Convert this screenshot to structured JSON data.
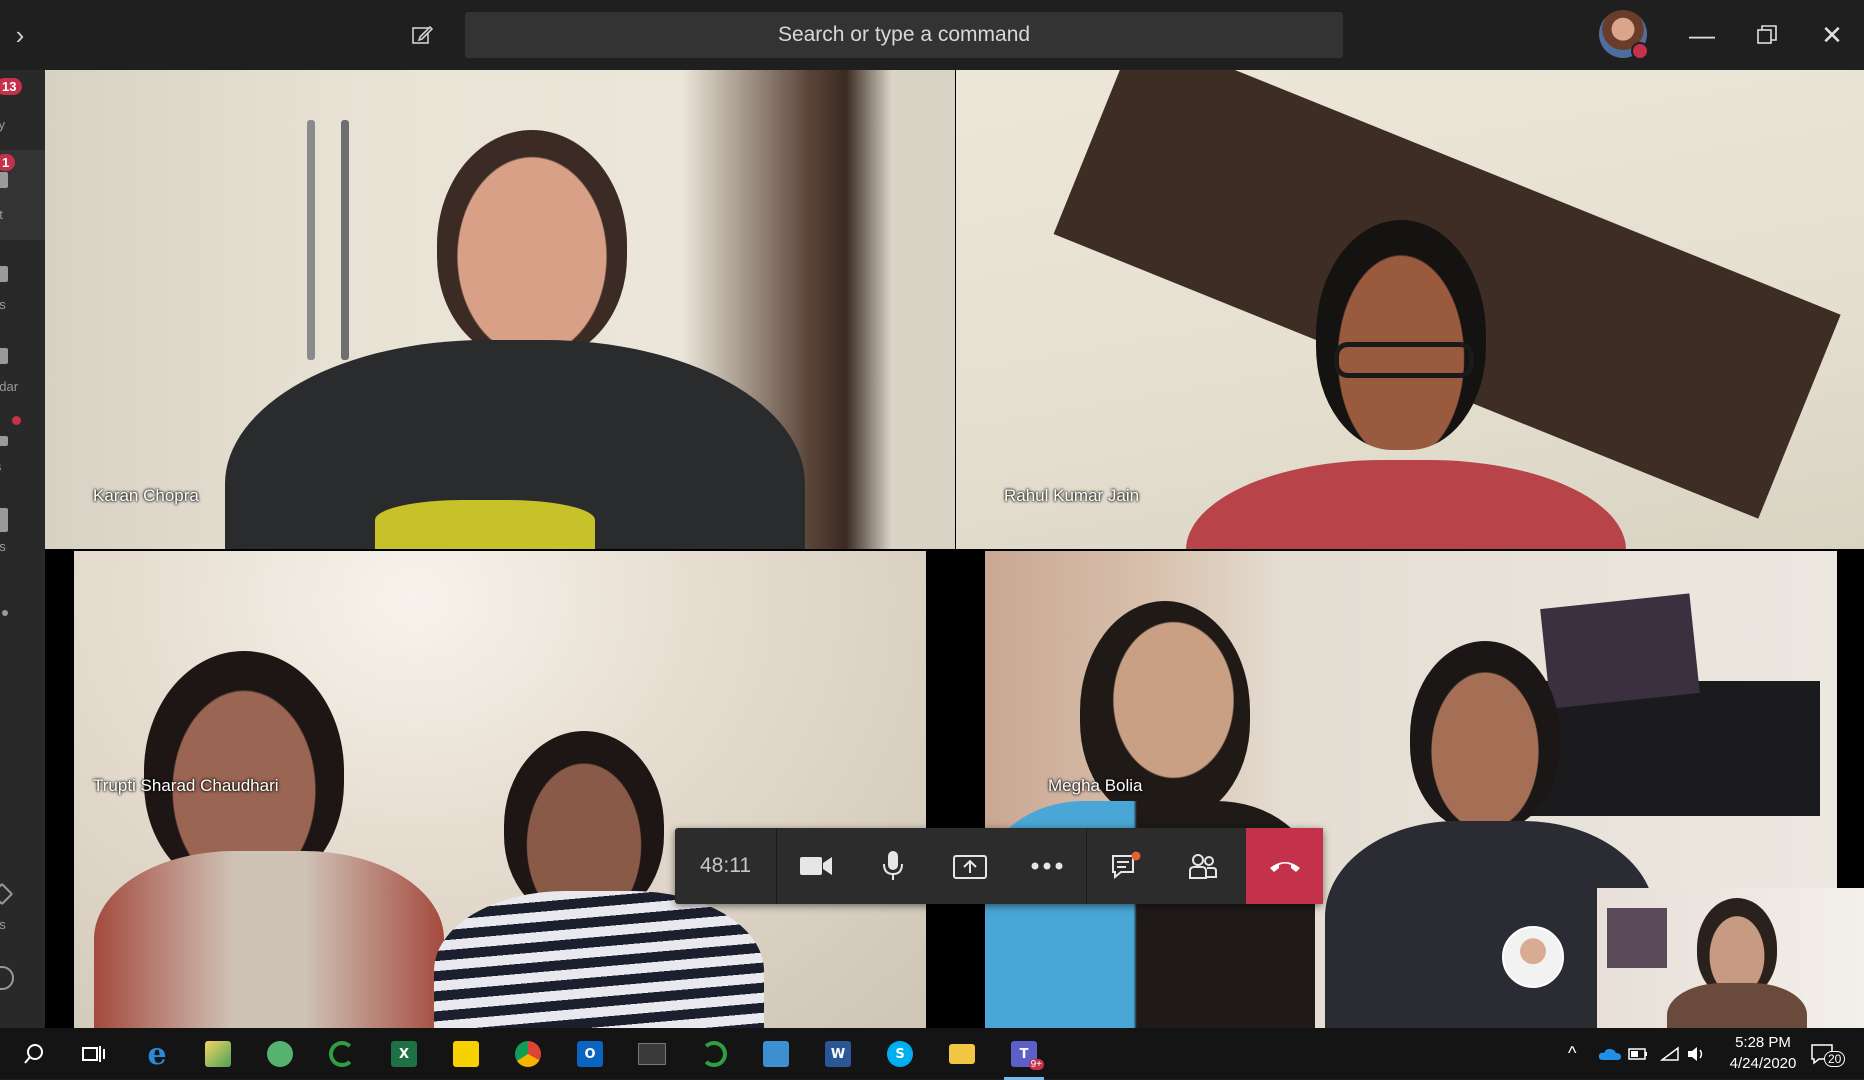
{
  "titlebar": {
    "search_placeholder": "Search or type a command"
  },
  "rail": {
    "items": [
      {
        "label": "ity",
        "badge": "13"
      },
      {
        "label": "at",
        "badge": "1"
      },
      {
        "label": "ns",
        "badge": ""
      },
      {
        "label": "ndar",
        "badge": ""
      },
      {
        "label": "ls",
        "badge": ""
      },
      {
        "label": "es",
        "badge": ""
      },
      {
        "label": "ps",
        "badge": ""
      },
      {
        "label": "p",
        "badge": ""
      }
    ]
  },
  "participants": [
    {
      "name": "Karan Chopra"
    },
    {
      "name": "Rahul Kumar Jain"
    },
    {
      "name": "Trupti Sharad Chaudhari"
    },
    {
      "name": "Megha Bolia"
    }
  ],
  "controls": {
    "timer": "48:11"
  },
  "taskbar": {
    "apps": [
      "search-icon",
      "task-view-icon",
      "edge-icon",
      "paint-icon",
      "atom-icon",
      "loader-icon",
      "excel-icon",
      "sticky-notes-icon",
      "chrome-icon",
      "outlook-icon",
      "terminal-icon",
      "loader-icon",
      "photos-icon",
      "word-icon",
      "skype-icon",
      "file-explorer-icon",
      "teams-icon"
    ],
    "excel_letter": "X",
    "outlook_letter": "O",
    "word_letter": "W",
    "teams_letter": "T",
    "teams_badge": "9+",
    "time": "5:28 PM",
    "date": "4/24/2020",
    "notifications": "20"
  },
  "colors": {
    "hangup": "#c4314b",
    "badge": "#c4314b",
    "accent": "#76b9ed"
  }
}
